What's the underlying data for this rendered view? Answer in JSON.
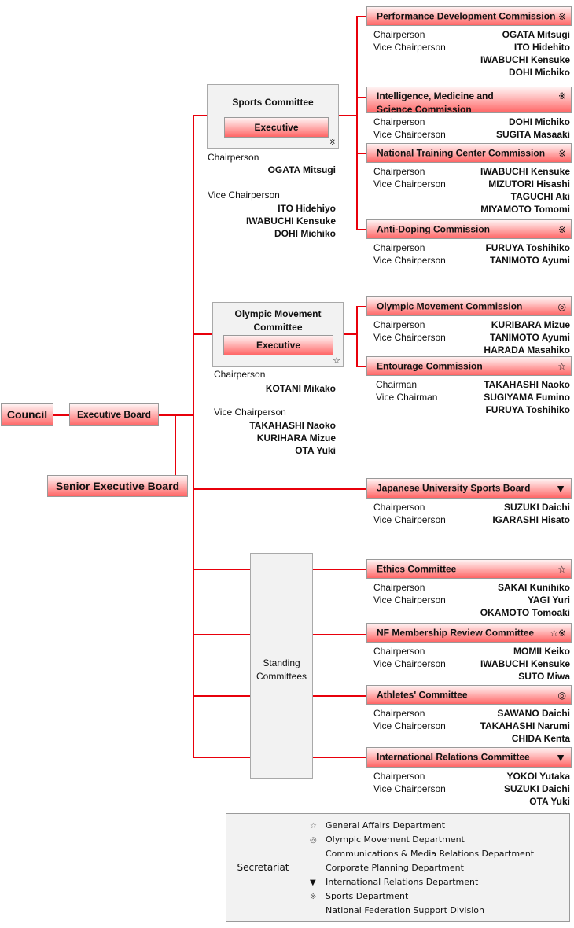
{
  "root": {
    "council": "Council",
    "executive_board": "Executive Board",
    "senior_executive_board": "Senior Executive Board"
  },
  "sports_committee": {
    "title": "Sports Committee",
    "executive_label": "Executive",
    "mark": "※",
    "chair_role": "Chairperson",
    "chair": "OGATA Mitsugi",
    "vice_role": "Vice Chairperson",
    "vices": [
      "ITO Hidehiyo",
      "IWABUCHI Kensuke",
      "DOHI Michiko"
    ]
  },
  "olympic_committee": {
    "title_line1": "Olympic Movement",
    "title_line2": "Committee",
    "executive_label": "Executive",
    "mark": "☆",
    "chair_role": "Chairperson",
    "chair": "KOTANI Mikako",
    "vice_role": "Vice Chairperson",
    "vices": [
      "TAKAHASHI Naoko",
      "KURIHARA Mizue",
      "OTA Yuki"
    ]
  },
  "standing": {
    "line1": "Standing",
    "line2": "Committees"
  },
  "commissions": [
    {
      "title": "Performance Development Commission",
      "mark": "※",
      "chair_role": "Chairperson",
      "vice_role": "Vice Chairperson",
      "names": [
        "OGATA Mitsugi",
        "ITO Hidehito",
        "IWABUCHI Kensuke",
        "DOHI Michiko"
      ]
    },
    {
      "title_line1": "Intelligence, Medicine and",
      "title_line2": "Science Commission",
      "mark": "※",
      "chair_role": "Chairperson",
      "vice_role": "Vice Chairperson",
      "names": [
        "DOHI Michiko",
        "SUGITA Masaaki"
      ]
    },
    {
      "title": "National Training Center Commission",
      "mark": "※",
      "chair_role": "Chairperson",
      "vice_role": "Vice Chairperson",
      "names": [
        "IWABUCHI Kensuke",
        "MIZUTORI Hisashi",
        "TAGUCHI Aki",
        "MIYAMOTO Tomomi"
      ]
    },
    {
      "title": "Anti-Doping Commission",
      "mark": "※",
      "chair_role": "Chairperson",
      "vice_role": "Vice Chairperson",
      "names": [
        "FURUYA Toshihiko",
        "TANIMOTO Ayumi"
      ]
    },
    {
      "title": "Olympic Movement Commission",
      "mark": "◎",
      "chair_role": "Chairperson",
      "vice_role": "Vice Chairperson",
      "names": [
        "KURIBARA Mizue",
        "TANIMOTO Ayumi",
        "HARADA Masahiko"
      ]
    },
    {
      "title": "Entourage Commission",
      "mark": "☆",
      "chair_role": "Chairman",
      "vice_role": "Vice Chairman",
      "names": [
        "TAKAHASHI Naoko",
        "SUGIYAMA Fumino",
        "FURUYA Toshihiko"
      ]
    },
    {
      "title": "Japanese University Sports Board",
      "mark": "▼",
      "chair_role": "Chairperson",
      "vice_role": "Vice Chairperson",
      "names": [
        "SUZUKI Daichi",
        "IGARASHI Hisato"
      ]
    },
    {
      "title": "Ethics Committee",
      "mark": "☆",
      "chair_role": "Chairperson",
      "vice_role": "Vice Chairperson",
      "names": [
        "SAKAI Kunihiko",
        "YAGI Yuri",
        "OKAMOTO Tomoaki"
      ]
    },
    {
      "title": "NF Membership Review Committee",
      "mark": "☆※",
      "chair_role": "Chairperson",
      "vice_role": "Vice Chairperson",
      "names": [
        "MOMII Keiko",
        "IWABUCHI Kensuke",
        "SUTO Miwa"
      ]
    },
    {
      "title": "Athletes' Committee",
      "mark": "◎",
      "chair_role": "Chairperson",
      "vice_role": "Vice Chairperson",
      "names": [
        "SAWANO Daichi",
        "TAKAHASHI Narumi",
        "CHIDA Kenta"
      ]
    },
    {
      "title": "International Relations Committee",
      "mark": "▼",
      "chair_role": "Chairperson",
      "vice_role": "Vice Chairperson",
      "names": [
        "YOKOI Yutaka",
        "SUZUKI Daichi",
        "OTA Yuki"
      ]
    }
  ],
  "secretariat": {
    "label": "Secretariat",
    "departments": [
      {
        "symbol": "☆",
        "name": "General Affairs Department"
      },
      {
        "symbol": "◎",
        "name": "Olympic Movement Department"
      },
      {
        "symbol": "",
        "name": "Communications & Media Relations Department"
      },
      {
        "symbol": "",
        "name": "Corporate Planning Department"
      },
      {
        "symbol": "▼",
        "name": "International Relations Department"
      },
      {
        "symbol": "※",
        "name": "Sports Department"
      },
      {
        "symbol": "",
        "name": "National Federation Support Division"
      }
    ]
  }
}
